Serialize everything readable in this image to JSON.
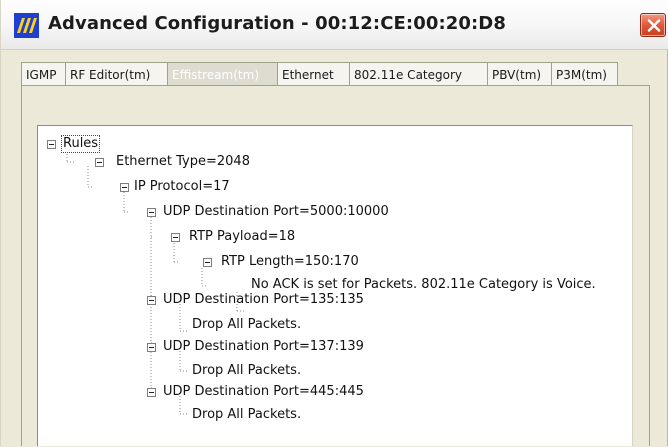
{
  "window": {
    "title": "Advanced Configuration - 00:12:CE:00:20:D8"
  },
  "tabs": [
    {
      "label": "IGMP",
      "selected": false
    },
    {
      "label": "RF Editor(tm)",
      "selected": false
    },
    {
      "label": "Effistream(tm)",
      "selected": true
    },
    {
      "label": "Ethernet",
      "selected": false
    },
    {
      "label": "802.11e Category",
      "selected": false
    },
    {
      "label": "PBV(tm)",
      "selected": false
    },
    {
      "label": "P3M(tm)",
      "selected": false
    }
  ],
  "tree": {
    "root": "Rules",
    "ethertype": "Ethernet Type=2048",
    "ip_protocol": "IP Protocol=17",
    "udp1": "UDP Destination Port=5000:10000",
    "rtp_payload": "RTP Payload=18",
    "rtp_length": "RTP Length=150:170",
    "rtp_action": "No ACK is set for Packets. 802.11e Category is Voice.",
    "udp2": "UDP Destination Port=135:135",
    "udp2_action": "Drop All Packets.",
    "udp3": "UDP Destination Port=137:139",
    "udp3_action": "Drop All Packets.",
    "udp4": "UDP Destination Port=445:445",
    "udp4_action": "Drop All Packets."
  },
  "colors": {
    "accent_icon": "#1f3fd0",
    "close_button": "#d9532f",
    "selected_tab_text": "#ffffff"
  },
  "icons": {
    "app": "app-logo-icon",
    "close": "close-icon",
    "expand": "collapse-minus-icon"
  }
}
